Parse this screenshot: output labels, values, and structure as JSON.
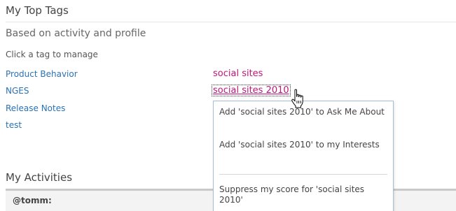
{
  "top_tags": {
    "title": "My Top Tags",
    "subtitle": "Based on activity and profile",
    "hint": "Click a tag to manage",
    "left_tags": [
      "Product Behavior",
      "NGES",
      "Release Notes",
      "test"
    ],
    "right_tags": [
      "social sites",
      "social sites 2010"
    ]
  },
  "context_menu": {
    "items": [
      "Add 'social sites 2010' to Ask Me About",
      "Add 'social sites 2010' to my Interests",
      "Suppress my score for 'social sites 2010'"
    ]
  },
  "activities": {
    "title": "My Activities",
    "user": "@tomm:"
  },
  "colors": {
    "link_blue": "#2a72b5",
    "tag_pink": "#c1157a",
    "menu_border": "#a9bed4"
  },
  "icons": {
    "cursor": "hand-pointer-icon"
  }
}
